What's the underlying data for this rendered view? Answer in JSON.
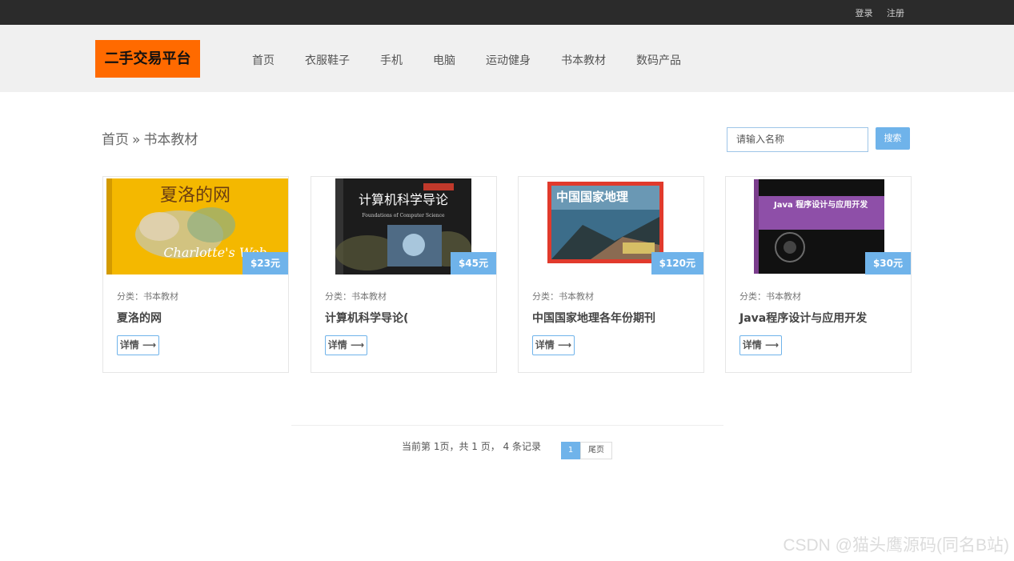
{
  "topbar": {
    "login": "登录",
    "register": "注册"
  },
  "header": {
    "logo": "二手交易平台",
    "nav": [
      "首页",
      "衣服鞋子",
      "手机",
      "电脑",
      "运动健身",
      "书本教材",
      "数码产品"
    ]
  },
  "breadcrumb": {
    "home": "首页",
    "sep": "»",
    "current": "书本教材"
  },
  "search": {
    "placeholder": "请输入名称",
    "button": "搜索"
  },
  "products": [
    {
      "price": "$23元",
      "category": "分类：书本教材",
      "title": "夏洛的网",
      "detail": "详情 ⟶",
      "cover_text": "夏洛的网",
      "cover_sub": "Charlotte's Web"
    },
    {
      "price": "$45元",
      "category": "分类：书本教材",
      "title": "计算机科学导论(",
      "detail": "详情 ⟶",
      "cover_text": "计算机科学导论",
      "cover_sub": "Foundations of Computer Science"
    },
    {
      "price": "$120元",
      "category": "分类：书本教材",
      "title": "中国国家地理各年份期刊",
      "detail": "详情 ⟶",
      "cover_text": "中国国家地理",
      "cover_sub": ""
    },
    {
      "price": "$30元",
      "category": "分类：书本教材",
      "title": "Java程序设计与应用开发",
      "detail": "详情 ⟶",
      "cover_text": "Java 程序设计与应用开发",
      "cover_sub": ""
    }
  ],
  "pagination": {
    "info": "当前第 1页，共 1 页， 4 条记录",
    "current": "1",
    "last": "尾页"
  },
  "watermark": "CSDN @猫头鹰源码(同名B站)",
  "colors": {
    "accent": "#6fb3ea",
    "logo_bg": "#ff6a00",
    "topbar_bg": "#2b2b2b",
    "header_bg": "#f0f0f0"
  }
}
